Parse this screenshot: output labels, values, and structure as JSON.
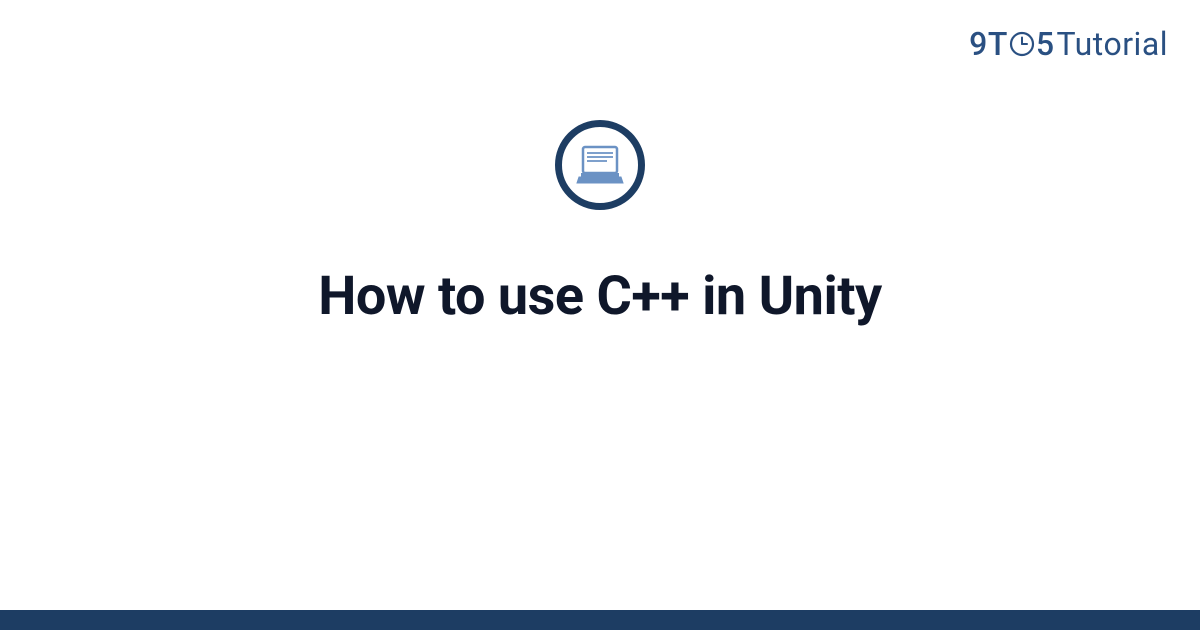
{
  "brand": {
    "part1": "9",
    "part2": "T",
    "part3": "5",
    "part4": "Tutorial"
  },
  "main": {
    "title": "How to use C++ in Unity"
  },
  "colors": {
    "primary": "#1d3d63",
    "brand_text": "#2a5082",
    "icon_accent": "#6b92c4"
  }
}
